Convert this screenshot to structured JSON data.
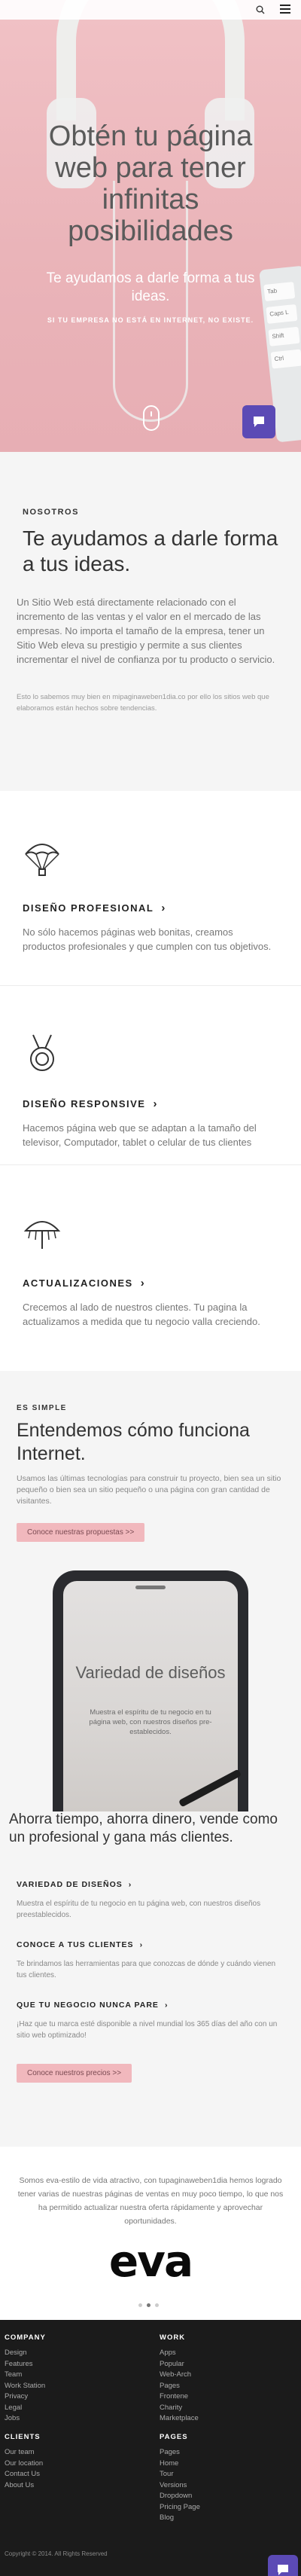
{
  "hero": {
    "title": "Obtén tu página web para tener infinitas posibilidades",
    "subtitle": "Te ayudamos a darle forma a tus ideas.",
    "tagline": "SI TU EMPRESA NO ESTÁ EN INTERNET, NO EXISTE.",
    "keyboard_keys": [
      "Tab",
      "Caps L",
      "Shift",
      "Ctrl"
    ]
  },
  "about": {
    "eyebrow": "NOSOTROS",
    "heading": "Te ayudamos a darle forma a tus ideas.",
    "lead": "Un Sitio Web está directamente relacionado con el incremento de las ventas y el valor en el mercado de las empresas. No importa el tamaño de la empresa, tener un Sitio Web eleva su prestigio y permite a sus clientes incrementar el nivel de confianza por tu producto o servicio.",
    "small": "Esto lo sabemos muy bien en mipaginaweben1dia.co por ello los sitios web que elaboramos están hechos sobre tendencias."
  },
  "features": [
    {
      "title": "DISEÑO PROFESIONAL",
      "text": "No sólo hacemos páginas web bonitas, creamos productos profesionales y que cumplen con tus objetivos."
    },
    {
      "title": "DISEÑO RESPONSIVE",
      "text": "Hacemos página web que se adaptan a la tamaño del televisor, Computador, tablet o celular de tus clientes"
    },
    {
      "title": "ACTUALIZACIONES",
      "text": "Crecemos al lado de nuestros clientes. Tu pagina la actualizamos a medida que tu negocio valla creciendo."
    }
  ],
  "how": {
    "eyebrow": "ES SIMPLE",
    "heading": "Entendemos cómo funciona Internet.",
    "intro": "Usamos las últimas tecnologías para construir tu proyecto, bien sea un sitio pequeño o bien sea un sitio pequeño o una página con gran cantidad de visitantes.",
    "button1": "Conoce nuestras propuestas >>",
    "phone_title": "Variedad de diseños",
    "phone_text": "Muestra el espíritu de tu negocio en tu página web, con nuestros diseños pre- establecidos.",
    "slogan": "Ahorra tiempo, ahorra dinero, vende como un profesional y gana más clientes.",
    "steps": [
      {
        "title": "VARIEDAD DE DISEÑOS",
        "text": "Muestra el espíritu de tu negocio en tu página web, con nuestros diseños preestablecidos."
      },
      {
        "title": "CONOCE A TUS CLIENTES",
        "text": "Te brindamos las herramientas para que conozcas de dónde y cuándo vienen tus clientes."
      },
      {
        "title": "QUE TU NEGOCIO NUNCA PARE",
        "text": "¡Haz que tu marca esté disponible a nivel mundial los 365 días del año con un sitio web optimizado!"
      }
    ],
    "button2": "Conoce nuestros precios >>"
  },
  "client": {
    "text": "Somos eva-estilo de vida atractivo, con tupaginaweben1dia hemos logrado tener varias de nuestras páginas de ventas en muy poco tiempo, lo que nos ha permitido actualizar nuestra oferta rápidamente y aprovechar oportunidades.",
    "logo": "eva"
  },
  "footer": {
    "company": {
      "title": "COMPANY",
      "links": [
        "Design",
        "Features",
        "Team",
        "Work Station",
        "Privacy",
        "Legal",
        "Jobs"
      ]
    },
    "work": {
      "title": "WORK",
      "links": [
        "Apps",
        "Popular",
        "Web-Arch",
        "Pages",
        "Frontene",
        "Charity",
        "Marketplace"
      ]
    },
    "clients": {
      "title": "CLIENTS",
      "links": [
        "Our team",
        "Our location",
        "Contact Us",
        "About Us"
      ]
    },
    "pages": {
      "title": "PAGES",
      "links": [
        "Pages",
        "Home",
        "Tour",
        "Versions",
        "Dropdown",
        "Pricing Page",
        "Blog"
      ]
    },
    "copyright": "Copyright © 2014. All Rights Reserved"
  },
  "colors": {
    "accent_pink": "#f1b8bd",
    "chat_purple": "#5b4ab5",
    "footer_bg": "#1b1b1b"
  }
}
